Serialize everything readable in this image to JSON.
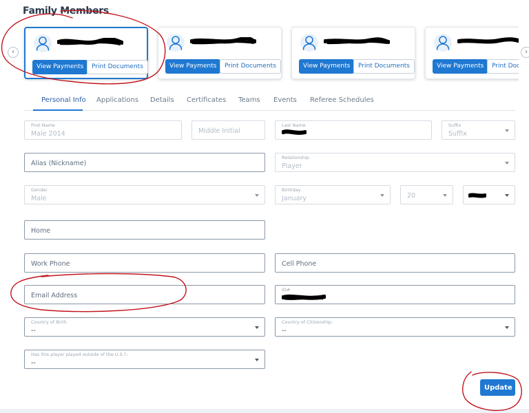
{
  "page": {
    "title": "Family Members"
  },
  "carousel": {
    "prev_glyph": "‹",
    "next_glyph": "›",
    "cards": [
      {
        "name": "",
        "view_label": "View Payments",
        "print_label": "Print Documents",
        "selected": true
      },
      {
        "name": "",
        "view_label": "View Payments",
        "print_label": "Print Documents",
        "selected": false
      },
      {
        "name": "",
        "view_label": "View Payments",
        "print_label": "Print Documents",
        "selected": false
      },
      {
        "name": "",
        "view_label": "View Payments",
        "print_label": "Print Docu",
        "selected": false
      }
    ]
  },
  "tabs": [
    "Personal Info",
    "Applications",
    "Details",
    "Certificates",
    "Teams",
    "Events",
    "Referee Schedules"
  ],
  "form": {
    "first_name": {
      "label": "First Name",
      "value": "Male 2014"
    },
    "middle_initial": {
      "placeholder": "Middle Initial"
    },
    "last_name": {
      "label": "Last Name"
    },
    "suffix": {
      "label": "Suffix",
      "value": "Suffix"
    },
    "alias": {
      "placeholder": "Alias (Nickname)"
    },
    "relationship": {
      "label": "Relationship",
      "value": "Player"
    },
    "gender": {
      "label": "Gender",
      "value": "Male"
    },
    "birthday": {
      "label": "Birthday",
      "month": "January",
      "day": "20"
    },
    "home": {
      "placeholder": "Home"
    },
    "work_phone": {
      "placeholder": "Work Phone"
    },
    "cell_phone": {
      "placeholder": "Cell Phone"
    },
    "email": {
      "placeholder": "Email Address"
    },
    "id": {
      "label": "ID#"
    },
    "country_of_birth": {
      "label": "Country of Birth",
      "value": "--"
    },
    "country_of_citizenship": {
      "label": "Country of Citizenship:",
      "value": "--"
    },
    "played_outside": {
      "label": "Has this player played outside of the U.S.?:",
      "value": "--"
    }
  },
  "actions": {
    "update_label": "Update"
  },
  "colors": {
    "accent": "#1f78d1",
    "annotation": "#c0141c"
  }
}
